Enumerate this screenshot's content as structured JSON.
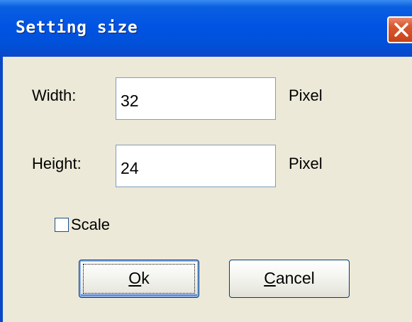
{
  "window": {
    "title": "Setting size"
  },
  "colors": {
    "titlebar": "#0054e3",
    "dialog_bg": "#ece9d8",
    "close_button": "#d9582f",
    "button_border": "#003c74"
  },
  "icons": {
    "close": "close-icon"
  },
  "form": {
    "width_label": "Width:",
    "width_value": "32",
    "width_unit": "Pixel",
    "height_label": "Height:",
    "height_value": "24",
    "height_unit": "Pixel",
    "scale_label": "Scale",
    "scale_checked": false
  },
  "buttons": {
    "ok_mnemonic": "O",
    "ok_rest": "k",
    "cancel_mnemonic": "C",
    "cancel_rest": "ancel"
  }
}
